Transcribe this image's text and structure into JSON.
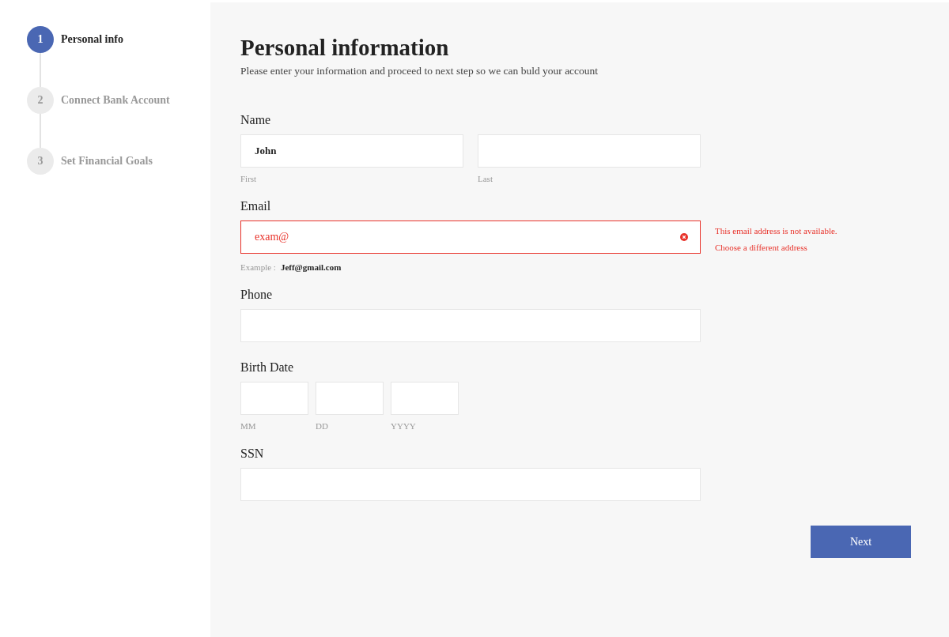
{
  "steps": [
    {
      "number": "1",
      "label": "Personal info",
      "selected": true
    },
    {
      "number": "2",
      "label": "Connect Bank Account",
      "selected": false
    },
    {
      "number": "3",
      "label": "Set Financial Goals",
      "selected": false
    }
  ],
  "title": "Personal information",
  "subtitle": "Please enter your information and proceed to next step so we can buld your account",
  "form": [
    {
      "kind": "split",
      "label": "Name",
      "inputs": [
        {
          "value": "John",
          "caption": "First"
        },
        {
          "caption": "Last"
        }
      ]
    },
    {
      "kind": "email",
      "label": "Email",
      "value": "exam@",
      "error": true,
      "errors": [
        "This email address is not available.",
        "Choose a different address"
      ],
      "example_label": "Example :",
      "example_value": "Jeff@gmail.com"
    },
    {
      "kind": "single",
      "label": "Phone"
    },
    {
      "kind": "date",
      "label": "Birth Date",
      "inputs": [
        {
          "caption": "MM"
        },
        {
          "caption": "DD"
        },
        {
          "caption": "YYYY"
        }
      ]
    },
    {
      "kind": "single",
      "label": "SSN"
    }
  ],
  "next_button": "Next"
}
